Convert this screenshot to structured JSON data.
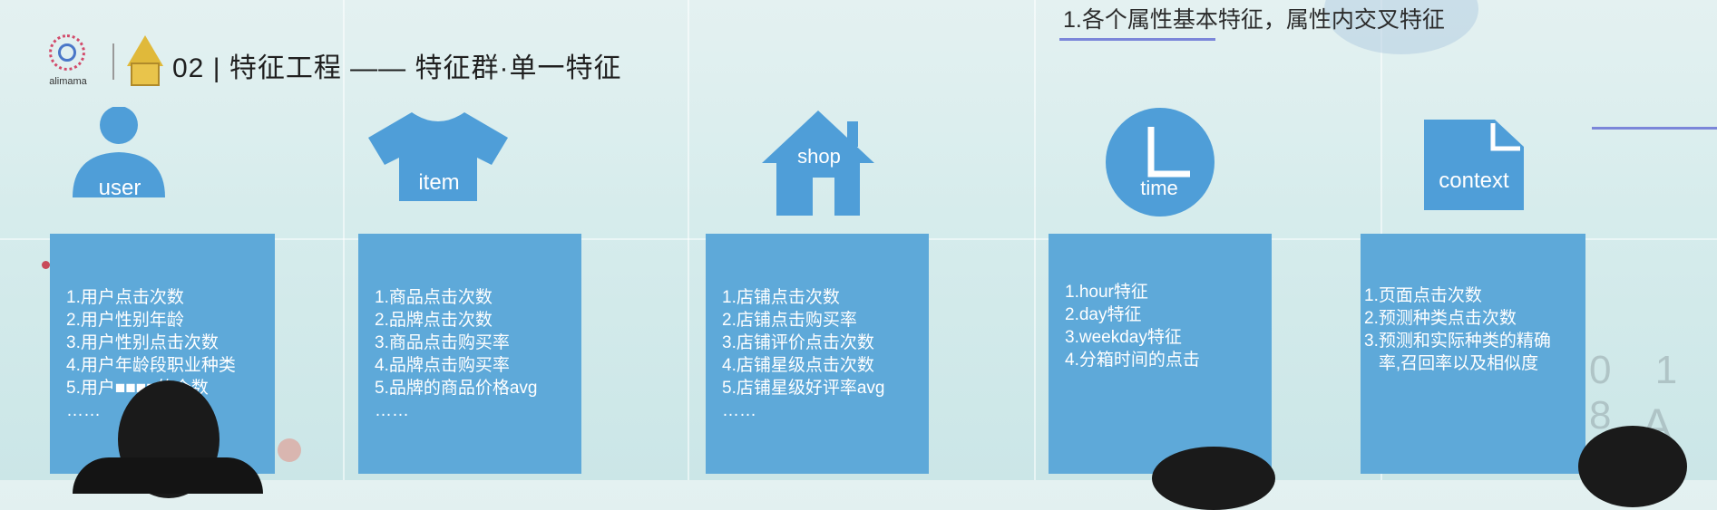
{
  "header": {
    "brand_text": "alimama",
    "title": "02 | 特征工程  ——  特征群·单一特征",
    "top_right_title": "1.各个属性基本特征，属性内交叉特征"
  },
  "categories": [
    {
      "icon": "person-icon",
      "label": "user",
      "lines": [
        "1.用户点击次数",
        "2.用户性别年龄",
        "3.用户性别点击次数",
        "4.用户年龄段职业种类",
        "5.用户■■■■的个数",
        "……"
      ]
    },
    {
      "icon": "tshirt-icon",
      "label": "item",
      "lines": [
        "1.商品点击次数",
        "2.品牌点击次数",
        "3.商品点击购买率",
        "4.品牌点击购买率",
        "5.品牌的商品价格avg",
        "……"
      ]
    },
    {
      "icon": "house-icon",
      "label": "shop",
      "lines": [
        "1.店铺点击次数",
        "2.店铺点击购买率",
        "3.店铺评价点击次数",
        "4.店铺星级点击次数",
        "5.店铺星级好评率avg",
        "……"
      ]
    },
    {
      "icon": "clock-icon",
      "label": "time",
      "lines": [
        "1.hour特征",
        "2.day特征",
        "3.weekday特征",
        "4.分箱时间的点击"
      ]
    },
    {
      "icon": "document-icon",
      "label": "context",
      "lines": [
        "1.页面点击次数",
        "2.预测种类点击次数",
        "3.预测和实际种类的精确",
        "   率,召回率以及相似度"
      ]
    }
  ],
  "watermark": {
    "text_top": "0 1 8",
    "text_bottom": "A I"
  },
  "colors": {
    "panel": "#5ea9d9",
    "icon": "#4f9ed8",
    "accent_line": "#7b86d9",
    "background": "#d6ecec"
  }
}
